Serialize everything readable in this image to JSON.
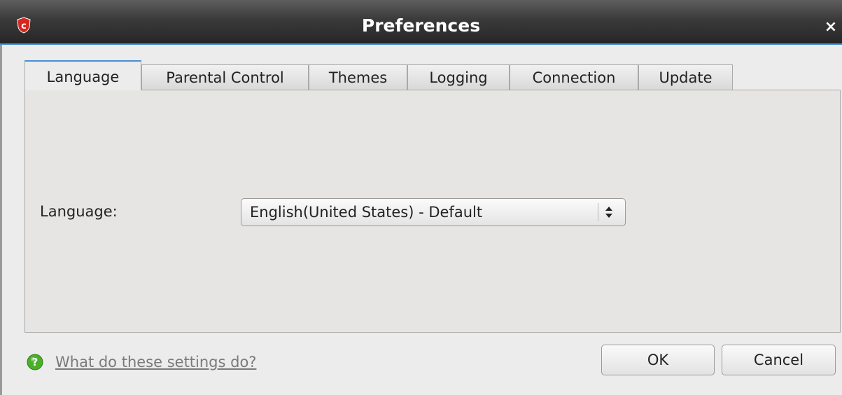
{
  "window": {
    "title": "Preferences",
    "close_glyph": "×",
    "app_icon": "comodo-shield-icon"
  },
  "tabs": [
    {
      "label": "Language",
      "active": true
    },
    {
      "label": "Parental Control",
      "active": false
    },
    {
      "label": "Themes",
      "active": false
    },
    {
      "label": "Logging",
      "active": false
    },
    {
      "label": "Connection",
      "active": false
    },
    {
      "label": "Update",
      "active": false
    }
  ],
  "language_panel": {
    "label": "Language:",
    "selected_value": "English(United States) - Default"
  },
  "footer": {
    "help_text": "What do these settings do?",
    "help_icon": "question-icon",
    "ok_label": "OK",
    "cancel_label": "Cancel"
  },
  "colors": {
    "accent": "#4a8fd0",
    "app_icon_red": "#d7261d",
    "help_icon_green": "#4caf2a"
  }
}
